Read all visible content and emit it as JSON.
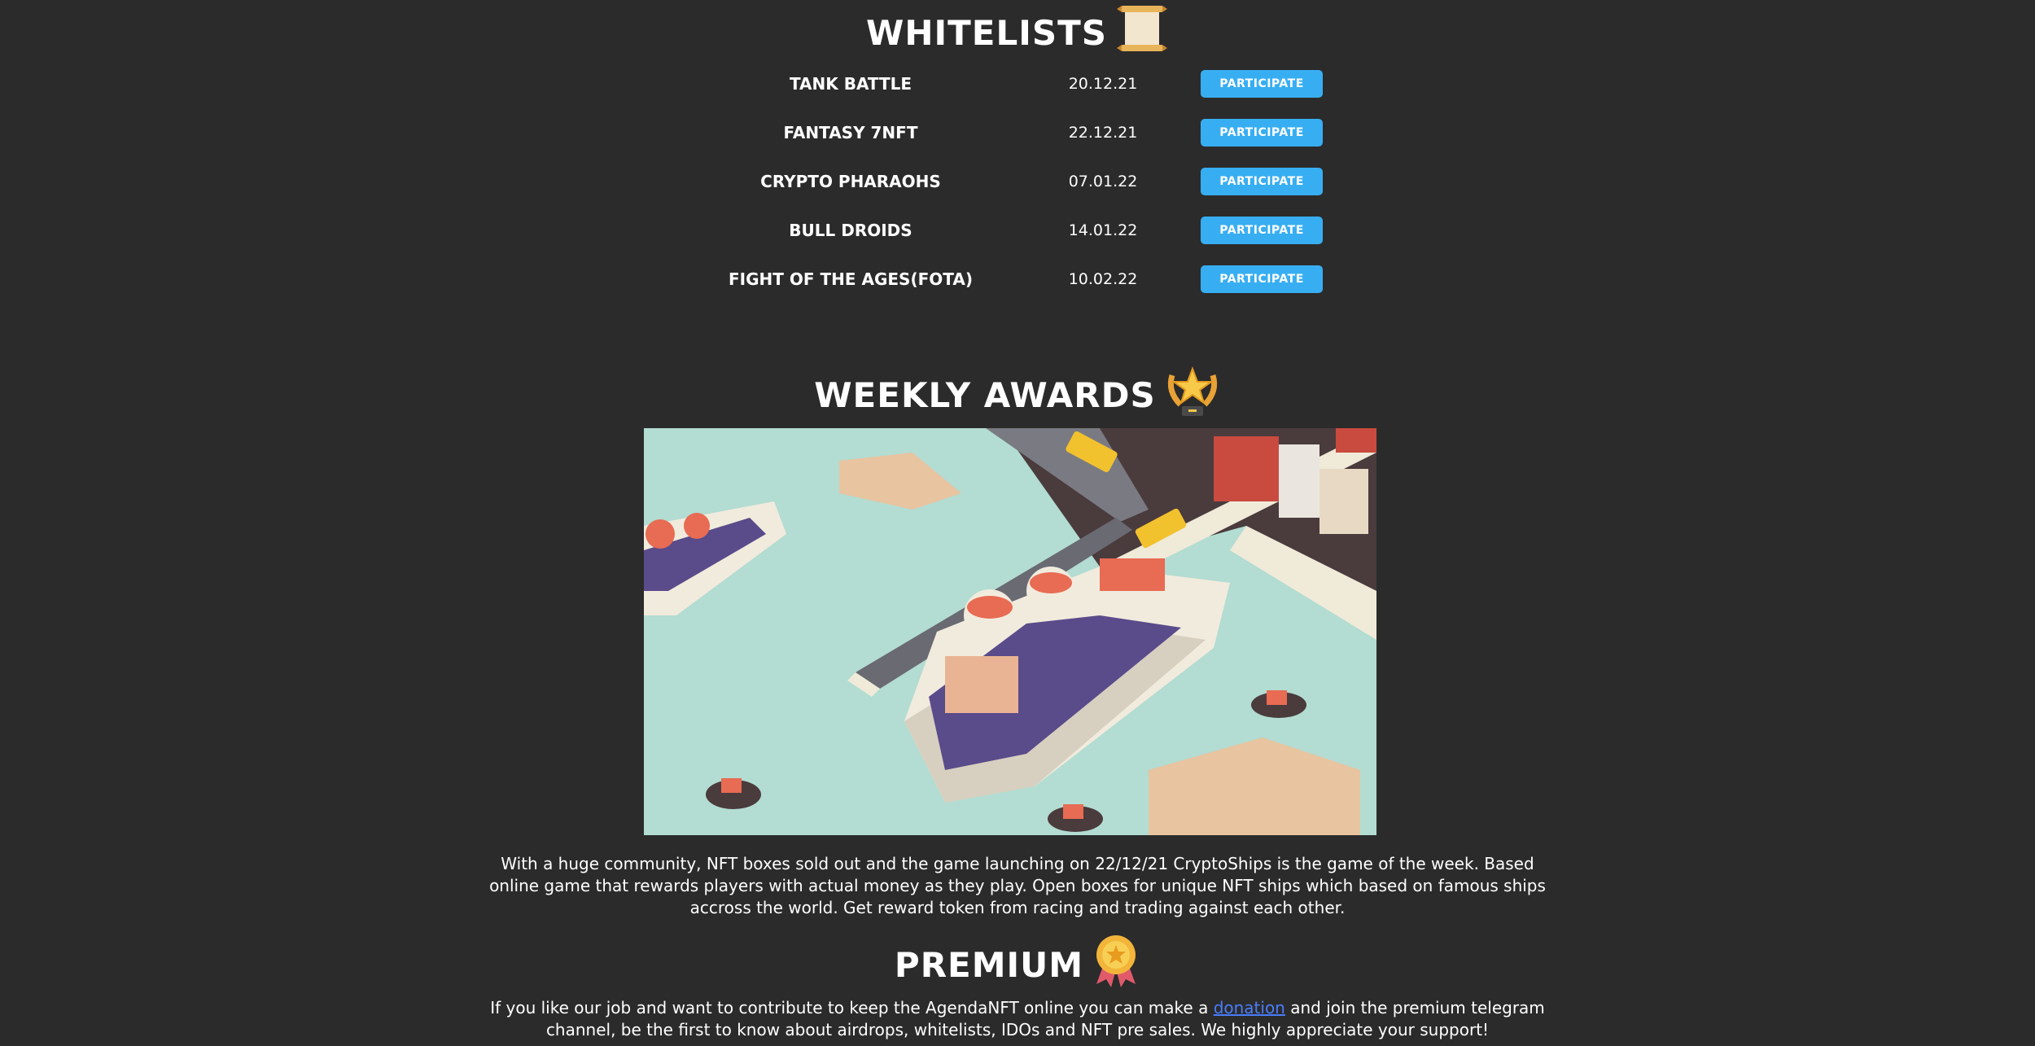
{
  "whitelists": {
    "title": "WHITELISTS",
    "icon": "scroll-icon",
    "rows": [
      {
        "name": "TANK BATTLE",
        "date": "20.12.21",
        "button": "PARTICIPATE"
      },
      {
        "name": "FANTASY 7NFT",
        "date": "22.12.21",
        "button": "PARTICIPATE"
      },
      {
        "name": "CRYPTO PHARAOHS",
        "date": "07.01.22",
        "button": "PARTICIPATE"
      },
      {
        "name": "BULL DROIDS",
        "date": "14.01.22",
        "button": "PARTICIPATE"
      },
      {
        "name": "FIGHT OF THE AGES(FOTA)",
        "date": "10.02.22",
        "button": "PARTICIPATE"
      }
    ],
    "button_color": "#38aef2"
  },
  "weekly_awards": {
    "title": "WEEKLY AWARDS",
    "icon": "laurel-star-trophy-icon",
    "image": "cruise-ship-harbor-illustration",
    "description": "With a huge community, NFT boxes sold out and the game launching on 22/12/21 CryptoShips is the game of the week. Based online game that rewards players with actual money as they play. Open boxes for unique NFT ships which based on famous ships accross the world. Get reward token from racing and trading against each other."
  },
  "premium": {
    "title": "PREMIUM",
    "icon": "medal-icon",
    "text_before": "If you like our job and want to contribute to keep the AgendaNFT online you can make a ",
    "link_text": "donation",
    "text_after": " and join the premium telegram channel, be the first to know about airdrops, whitelists, IDOs and NFT pre sales. We highly appreciate your support!"
  },
  "colors": {
    "background": "#2b2b2b",
    "link": "#4a7dfc"
  }
}
